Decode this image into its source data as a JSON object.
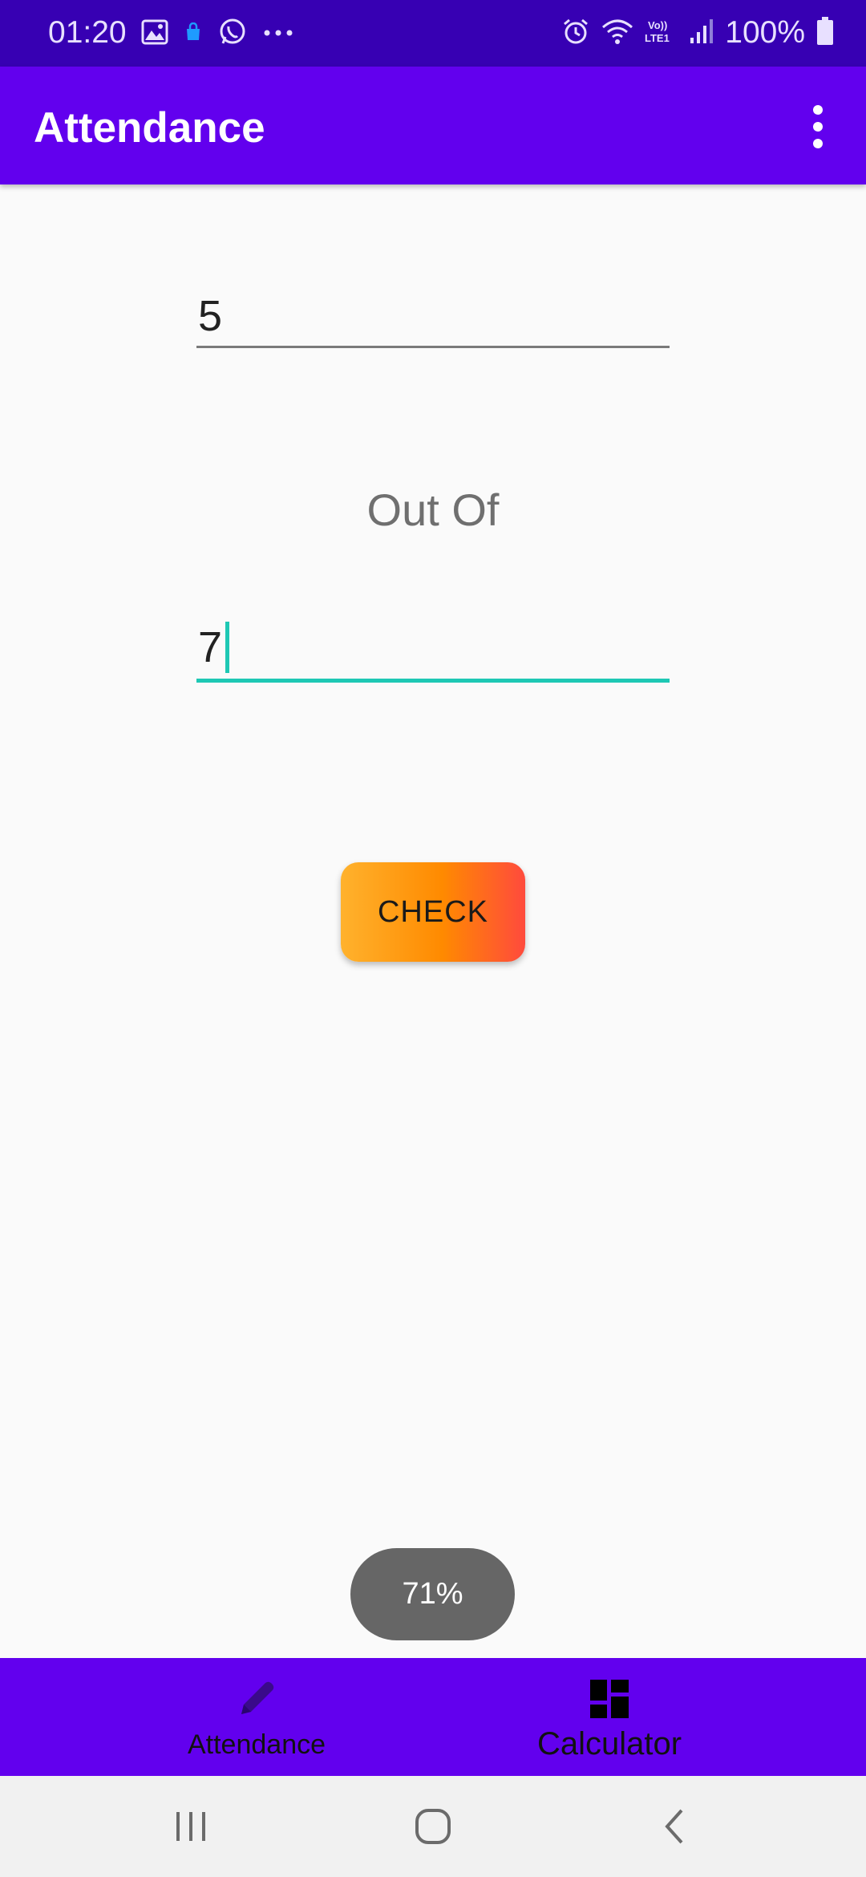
{
  "status_bar": {
    "time": "01:20",
    "left_icons": [
      "gallery-icon",
      "shopping-bag-icon",
      "whatsapp-icon",
      "more-notifications-icon"
    ],
    "right_icons": [
      "alarm-icon",
      "wifi-icon",
      "volte-icon",
      "signal-icon",
      "battery-icon"
    ],
    "volte_label": "Vo)) LTE1",
    "battery": "100%"
  },
  "app_bar": {
    "title": "Attendance",
    "menu_icon": "overflow-menu-icon"
  },
  "form": {
    "attended_value": "5",
    "out_of_label": "Out Of",
    "total_value": "7",
    "check_label": "CHECK"
  },
  "toast": {
    "text": "71%"
  },
  "bottom_nav": {
    "items": [
      {
        "label": "Attendance",
        "icon": "pencil-icon"
      },
      {
        "label": "Calculator",
        "icon": "dashboard-icon"
      }
    ]
  },
  "system_nav": {
    "buttons": [
      "recents-icon",
      "home-icon",
      "back-icon"
    ]
  },
  "colors": {
    "status_bar": "#3700b3",
    "app_bar": "#6200ee",
    "accent": "#1ec8b4",
    "button_gradient_start": "#ffb22d",
    "button_gradient_end": "#ff4a3d",
    "toast": "#666666"
  }
}
